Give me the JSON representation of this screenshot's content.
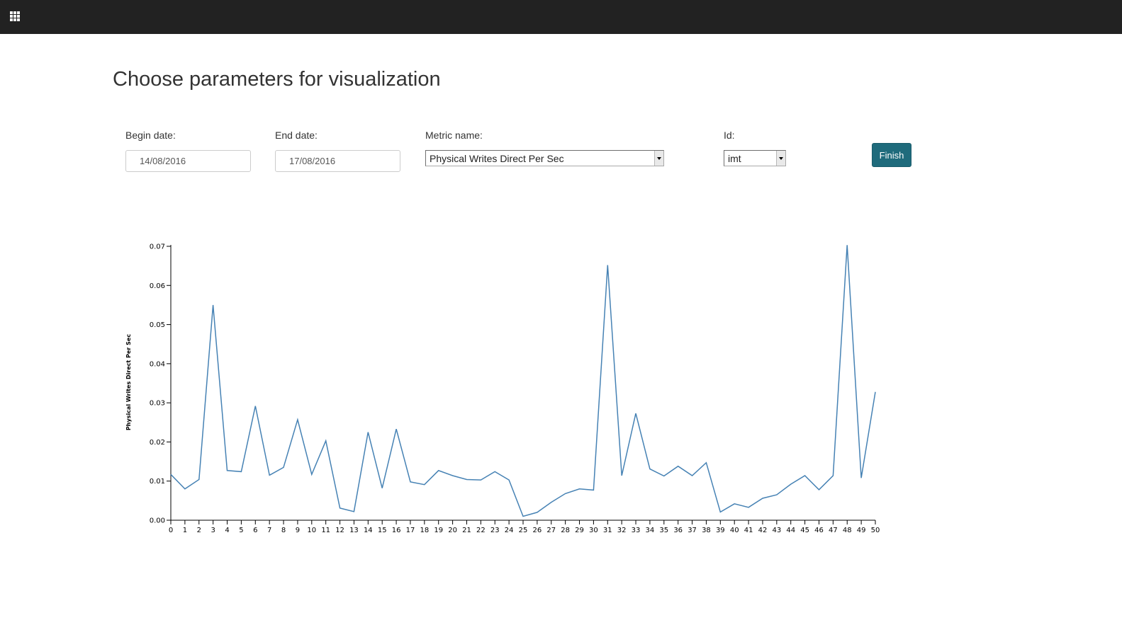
{
  "topbar": {
    "menu_icon": "apps-grid-icon"
  },
  "page": {
    "title": "Choose parameters for visualization"
  },
  "form": {
    "begin_date_label": "Begin date:",
    "begin_date_value": "14/08/2016",
    "end_date_label": "End date:",
    "end_date_value": "17/08/2016",
    "metric_label": "Metric name:",
    "metric_value": "Physical Writes Direct Per Sec",
    "id_label": "Id:",
    "id_value": "imt",
    "finish_label": "Finish"
  },
  "colors": {
    "topbar": "#222222",
    "button": "#1f6b7c",
    "line": "#4682b4"
  },
  "chart_data": {
    "type": "line",
    "ylabel": "Physical Writes Direct Per Sec",
    "xlabel": "",
    "ylim": [
      0,
      0.07
    ],
    "yticks": [
      "0.00",
      "0.01",
      "0.02",
      "0.03",
      "0.04",
      "0.05",
      "0.06",
      "0.07"
    ],
    "x": [
      0,
      1,
      2,
      3,
      4,
      5,
      6,
      7,
      8,
      9,
      10,
      11,
      12,
      13,
      14,
      15,
      16,
      17,
      18,
      19,
      20,
      21,
      22,
      23,
      24,
      25,
      26,
      27,
      28,
      29,
      30,
      31,
      32,
      33,
      34,
      35,
      36,
      37,
      38,
      39,
      40,
      41,
      42,
      43,
      44,
      45,
      46,
      47,
      48,
      49,
      50
    ],
    "values": [
      0.0117,
      0.008,
      0.0104,
      0.055,
      0.0127,
      0.0124,
      0.0292,
      0.0115,
      0.0135,
      0.0257,
      0.0117,
      0.0203,
      0.0031,
      0.0022,
      0.0225,
      0.0082,
      0.0233,
      0.0098,
      0.0091,
      0.0127,
      0.0114,
      0.0104,
      0.0103,
      0.0124,
      0.0103,
      0.001,
      0.002,
      0.0046,
      0.0068,
      0.008,
      0.0077,
      0.0652,
      0.0114,
      0.0273,
      0.0131,
      0.0113,
      0.0138,
      0.0114,
      0.0147,
      0.0021,
      0.0042,
      0.0033,
      0.0056,
      0.0065,
      0.0092,
      0.0114,
      0.0078,
      0.0114,
      0.0703,
      0.0108,
      0.0328
    ]
  }
}
